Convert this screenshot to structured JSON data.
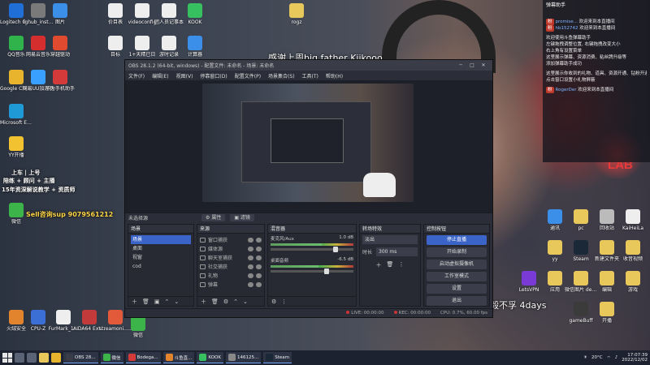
{
  "overlay": {
    "banner": "感谢上周big father Kiikooo",
    "quote": "坚毅不孚 4days",
    "live_line1": "上车 | 上号",
    "live_line2": "陪练 + 顾问 + 主播",
    "live_line3": "15年资深解说教学 + 资质师",
    "contact": "Sell咨询sup 9079561212"
  },
  "desktop_left": [
    {
      "label": "Logitech G HUB",
      "color": "#1f6fd6"
    },
    {
      "label": "lghub_inst...",
      "color": "#7a7a7a"
    },
    {
      "label": "图片",
      "color": "#3b8fe8"
    },
    {
      "label": "QQ音乐",
      "color": "#2fb34a"
    },
    {
      "label": "网易云音乐",
      "color": "#d52e2e"
    },
    {
      "label": "穿越驱动",
      "color": "#e04a2e"
    },
    {
      "label": "Google Chrome",
      "color": "#e8b42e"
    },
    {
      "label": "网易UU加速器",
      "color": "#3aa0ff"
    },
    {
      "label": "华为手机助手",
      "color": "#d43a3a"
    },
    {
      "label": "Microsoft Edge",
      "color": "#1f9ad6"
    },
    {
      "label": "YY开播",
      "color": "#f2c230"
    },
    {
      "label": "微信",
      "color": "#3cb44a"
    }
  ],
  "desktop_top": [
    {
      "label": "价目表",
      "color": "#eeeeee"
    },
    {
      "label": "videoconfig",
      "color": "#eeeeee"
    },
    {
      "label": "团人员记事本",
      "color": "#eeeeee"
    },
    {
      "label": "KOOK",
      "color": "#36c060"
    },
    {
      "label": "rogz",
      "color": "#e8c85a"
    },
    {
      "label": "目标",
      "color": "#eeeeee"
    },
    {
      "label": "1+天精已日",
      "color": "#eeeeee"
    },
    {
      "label": "游时记录",
      "color": "#eeeeee"
    },
    {
      "label": "计算器",
      "color": "#3b8fe8"
    }
  ],
  "desktop_bottom": [
    {
      "label": "火绒安全",
      "color": "#e2842e"
    },
    {
      "label": "CPU-Z",
      "color": "#3b6fd6"
    },
    {
      "label": "FurMark_1...",
      "color": "#eeeeee"
    },
    {
      "label": "AIDA64 Extreme",
      "color": "#c23a3a"
    },
    {
      "label": "streamoni... 快捷方式",
      "color": "#e25a3a"
    },
    {
      "label": "微信",
      "color": "#3cb44a"
    }
  ],
  "desktop_right": [
    {
      "label": "通讯",
      "color": "#3b8fe8"
    },
    {
      "label": "pc",
      "color": "#e8c85a"
    },
    {
      "label": "回收站",
      "color": "#bbbbbb"
    },
    {
      "label": "KaiHeiLa",
      "color": "#eeeeee"
    },
    {
      "label": "yy",
      "color": "#e8c85a"
    },
    {
      "label": "Steam",
      "color": "#1b2838"
    },
    {
      "label": "新建文件夹",
      "color": "#e8c85a"
    },
    {
      "label": "收音视频",
      "color": "#e8c85a"
    },
    {
      "label": "LetsVPN",
      "color": "#7a3ad6"
    },
    {
      "label": "应用",
      "color": "#e8c85a"
    },
    {
      "label": "微信图片 demo",
      "color": "#e8c85a"
    },
    {
      "label": "编辑",
      "color": "#e8c85a"
    },
    {
      "label": "游戏",
      "color": "#e8c85a"
    },
    {
      "label": "gameBuff",
      "color": "#3b3b3b"
    },
    {
      "label": "开播",
      "color": "#e8c85a"
    }
  ],
  "chat": {
    "header": "弹幕助手",
    "lines": [
      {
        "tag": "粉",
        "name": "promise...",
        "text": "欢迎来到本直播间"
      },
      {
        "tag": "粉",
        "name": "hb152742",
        "text": "欢迎来到本直播间"
      },
      {
        "tag": "",
        "name": "",
        "text": "欢迎使用斗鱼弹幕助手"
      },
      {
        "tag": "",
        "name": "",
        "text": "左键拖拽调整位置, 右键拖拽改变大小"
      },
      {
        "tag": "",
        "name": "",
        "text": "右上角有设置菜单"
      },
      {
        "tag": "",
        "name": "",
        "text": "这里展示弹幕、资源消费、粘丝牌升级等"
      },
      {
        "tag": "",
        "name": "",
        "text": "添加弹幕助手成功"
      },
      {
        "tag": "",
        "name": "",
        "text": "这里展示你收到的礼物、道具、资源开通、钻粉开通"
      },
      {
        "tag": "",
        "name": "",
        "text": "点击窗口设置小礼物屏蔽"
      },
      {
        "tag": "粉",
        "name": "RogerDer",
        "text": "欢迎来到本直播间"
      }
    ]
  },
  "obs": {
    "title": "OBS 28.1.2 (64-bit, windows) - 配置文件: 未命名 - 场景: 未命名",
    "menu": [
      "文件(F)",
      "编辑(E)",
      "视图(V)",
      "停靠窗口(D)",
      "配置文件(P)",
      "场景集合(S)",
      "工具(T)",
      "帮助(H)"
    ],
    "source_label": "未选择源",
    "props_btn": "属性",
    "filter_btn": "滤镜",
    "docks": {
      "scenes": {
        "title": "场景",
        "items": [
          "场景",
          "桌面",
          "视窗",
          "cod"
        ],
        "selected": 0
      },
      "sources": {
        "title": "来源",
        "items": [
          "窗口捕获",
          "媒体源",
          "聊天室捕获",
          "社交捕获",
          "礼物",
          "弹幕"
        ]
      },
      "mixer": {
        "title": "混音器",
        "channels": [
          {
            "name": "麦克风/Aux",
            "db": "1.0 dB",
            "level": 0.62,
            "fader": 0.78
          },
          {
            "name": "桌面音频",
            "db": "-6.5 dB",
            "level": 0.58,
            "fader": 0.68
          }
        ]
      },
      "transitions": {
        "title": "转场特效",
        "selected": "淡出",
        "duration_label": "时长",
        "duration": "300 ms"
      },
      "controls": {
        "title": "控制按钮",
        "buttons": [
          "停止直播",
          "开始录制",
          "启动虚拟摄像机",
          "工作室模式",
          "设置",
          "退出"
        ],
        "active": 0
      }
    },
    "status": {
      "live": "LIVE: 00:00:00",
      "rec": "REC: 00:00:00",
      "cpu": "CPU: 0.7%, 60.00 fps"
    }
  },
  "taskbar": {
    "apps": [
      {
        "label": "OBS 28...",
        "color": "#3a3d47"
      },
      {
        "label": "微信",
        "color": "#3cb44a"
      },
      {
        "label": "Bodega...",
        "color": "#d43a3a"
      },
      {
        "label": "斗鱼直...",
        "color": "#e2842e"
      },
      {
        "label": "KOOK",
        "color": "#36c060"
      },
      {
        "label": "146125...",
        "color": "#888888"
      },
      {
        "label": "Steam",
        "color": "#1b2838"
      }
    ],
    "temp": "20°C",
    "time": "17:07:39",
    "date": "2022/12/02"
  }
}
